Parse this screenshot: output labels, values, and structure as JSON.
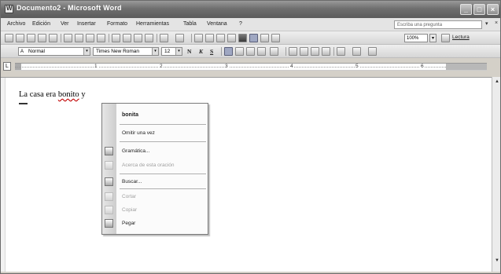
{
  "window": {
    "title": "Documento2 - Microsoft Word",
    "controls": {
      "minimize": "_",
      "maximize": "□",
      "close": "×"
    }
  },
  "menubar": {
    "items": [
      "Archivo",
      "Edición",
      "Ver",
      "Insertar",
      "Formato",
      "Herramientas",
      "Tabla",
      "Ventana",
      "?"
    ],
    "ask_placeholder": "Escriba una pregunta",
    "ask_arrow": "▾",
    "close": "×"
  },
  "standard_toolbar": {
    "zoom": "100%",
    "zoom_arrow": "▾",
    "reading_label": "Lectura"
  },
  "formatting_toolbar": {
    "style_glyph": "A",
    "style": "Normal",
    "font": "Times New Roman",
    "size": "12",
    "bold": "N",
    "italic": "K",
    "underline": "S",
    "drop_arrow": "▾"
  },
  "ruler": {
    "tab_selector": "L",
    "numbers": [
      "1",
      "2",
      "3",
      "4",
      "5",
      "6"
    ]
  },
  "document": {
    "text_before": "La casa era ",
    "misspelled_word": "bonito",
    "text_after": " y"
  },
  "context_menu": {
    "suggestion": "bonita",
    "items": [
      {
        "label": "Omitir una vez",
        "disabled": false
      },
      {
        "label": "Gramática...",
        "disabled": false
      },
      {
        "label": "Acerca de esta oración",
        "disabled": true
      },
      {
        "label": "Buscar...",
        "disabled": false
      },
      {
        "label": "Cortar",
        "disabled": true
      },
      {
        "label": "Copiar",
        "disabled": true
      },
      {
        "label": "Pegar",
        "disabled": false
      }
    ]
  },
  "scrollbar": {
    "up": "▲",
    "down": "▼"
  },
  "colors": {
    "titlebar": "#6f6f6f",
    "window_bg": "#d4d0c8",
    "spelling_underline": "#c00000"
  }
}
